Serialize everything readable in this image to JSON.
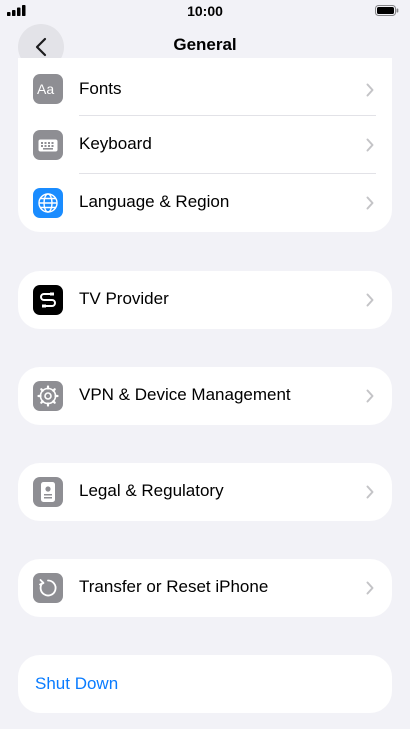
{
  "status_bar": {
    "time": "10:00"
  },
  "nav": {
    "title": "General"
  },
  "group1": [
    {
      "label": "Fonts",
      "icon": "fonts-icon"
    },
    {
      "label": "Keyboard",
      "icon": "keyboard-icon"
    },
    {
      "label": "Language & Region",
      "icon": "globe-icon"
    }
  ],
  "group2": [
    {
      "label": "TV Provider",
      "icon": "tv-provider-icon"
    }
  ],
  "group3": [
    {
      "label": "VPN & Device Management",
      "icon": "gear-icon"
    }
  ],
  "group4": [
    {
      "label": "Legal & Regulatory",
      "icon": "legal-icon"
    }
  ],
  "group5": [
    {
      "label": "Transfer or Reset iPhone",
      "icon": "reset-icon"
    }
  ],
  "group6": {
    "label": "Shut Down"
  },
  "colors": {
    "accent": "#0a7cff",
    "background": "#f2f2f7",
    "icon_gray": "#8e8e93",
    "icon_blue": "#1a8cff"
  }
}
